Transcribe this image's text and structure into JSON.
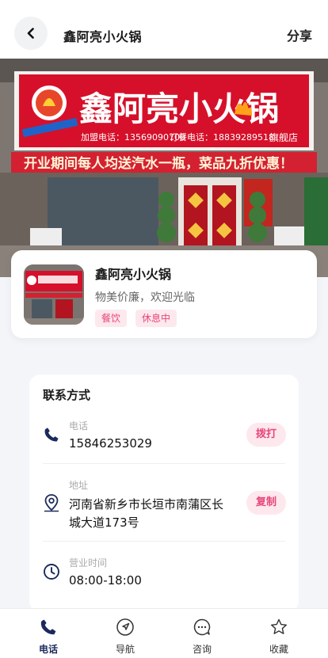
{
  "header": {
    "title": "鑫阿亮小火锅",
    "share_label": "分享",
    "back_icon": "chevron-left-icon"
  },
  "hero": {
    "sign_main": "鑫阿亮小火锅",
    "sign_phone": "加盟电话：13569090700",
    "sign_order": "订餐电话：18839289518",
    "sign_branch": "旗舰店",
    "banner": "开业期间每人均送汽水一瓶，菜品九折优惠！"
  },
  "store": {
    "name": "鑫阿亮小火锅",
    "slogan": "物美价廉，欢迎光临",
    "tags": [
      "餐饮",
      "休息中"
    ]
  },
  "contact": {
    "title": "联系方式",
    "phone": {
      "label": "电话",
      "value": "15846253029",
      "action": "拨打",
      "icon": "phone-icon"
    },
    "address": {
      "label": "地址",
      "value_line1": "河南省新乡市长垣市南蒲区长",
      "value_line2": "城大道173号",
      "action": "复制",
      "icon": "location-pin-icon"
    },
    "hours": {
      "label": "营业时间",
      "value": "08:00-18:00",
      "icon": "clock-icon"
    }
  },
  "nav": {
    "items": [
      {
        "label": "电话",
        "icon": "phone-icon"
      },
      {
        "label": "导航",
        "icon": "navigation-icon"
      },
      {
        "label": "咨询",
        "icon": "chat-icon"
      },
      {
        "label": "收藏",
        "icon": "star-icon"
      }
    ],
    "active_color": "#1b2a5c"
  },
  "colors": {
    "accent": "#e8457a",
    "accent_bg": "#fde8ee",
    "sign_red": "#d6102a"
  }
}
